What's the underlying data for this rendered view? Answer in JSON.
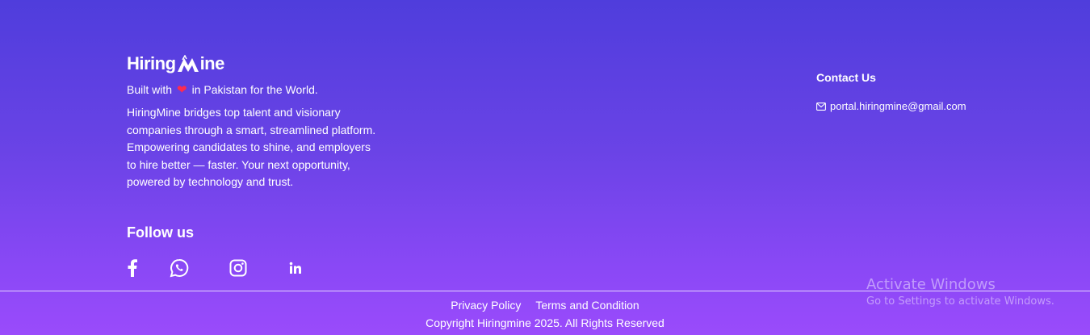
{
  "brand": {
    "logo_left": "Hiring",
    "logo_right": "ine"
  },
  "tagline": {
    "prefix": "Built with",
    "heart": "❤",
    "suffix": "in Pakistan for the World."
  },
  "description": "HiringMine bridges top talent and visionary companies through a smart, streamlined platform. Empowering candidates to shine, and employers to hire better — faster. Your next opportunity, powered by technology and trust.",
  "follow": {
    "title": "Follow us",
    "icons": [
      "facebook-icon",
      "whatsapp-icon",
      "instagram-icon",
      "linkedin-icon"
    ]
  },
  "contact": {
    "title": "Contact Us",
    "email": "portal.hiringmine@gmail.com"
  },
  "bottom": {
    "privacy": "Privacy Policy",
    "terms": "Terms and Condition",
    "copyright": "Copyright Hiringmine 2025. All Rights Reserved"
  },
  "watermark": {
    "line1": "Activate Windows",
    "line2": "Go to Settings to activate Windows."
  },
  "colors": {
    "gradient_top": "#4f3ddc",
    "gradient_bottom": "#9a4bfb",
    "heart": "#ff2b4f"
  }
}
